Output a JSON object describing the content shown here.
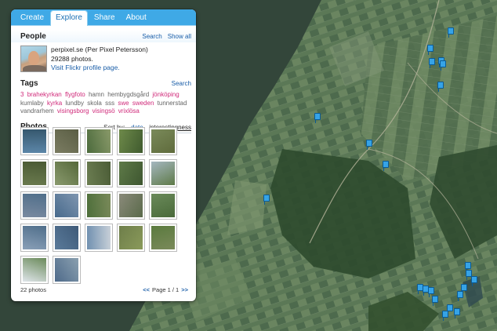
{
  "tabs": [
    {
      "label": "Create"
    },
    {
      "label": "Explore"
    },
    {
      "label": "Share"
    },
    {
      "label": "About"
    }
  ],
  "people": {
    "title": "People",
    "search_link": "Search",
    "show_all_link": "Show all",
    "user_name": "perpixel.se (Per Pixel Petersson)",
    "photo_count": "29288 photos.",
    "profile_link": "Visit Flickr profile page."
  },
  "tags": {
    "title": "Tags",
    "search_link": "Search",
    "items": [
      {
        "text": "3",
        "color": "#d02a7a"
      },
      {
        "text": "brahekyrkan",
        "color": "#d02a7a"
      },
      {
        "text": "flygfoto",
        "color": "#d02a7a"
      },
      {
        "text": "hamn",
        "color": "#666666"
      },
      {
        "text": "hembygdsgård",
        "color": "#666666"
      },
      {
        "text": "jönköping",
        "color": "#d02a7a"
      },
      {
        "text": "kumlaby",
        "color": "#666666"
      },
      {
        "text": "kyrka",
        "color": "#d02a7a"
      },
      {
        "text": "lundby",
        "color": "#666666"
      },
      {
        "text": "skola",
        "color": "#666666"
      },
      {
        "text": "sss",
        "color": "#666666"
      },
      {
        "text": "swe",
        "color": "#d02a7a"
      },
      {
        "text": "sweden",
        "color": "#d02a7a"
      },
      {
        "text": "tunnerstad",
        "color": "#666666"
      },
      {
        "text": "vandrarhem",
        "color": "#666666"
      },
      {
        "text": "visingsborg",
        "color": "#d02a7a"
      },
      {
        "text": "visingsö",
        "color": "#d02a7a"
      },
      {
        "text": "vrixlösa",
        "color": "#d02a7a"
      }
    ]
  },
  "photos": {
    "title": "Photos",
    "sort_by_label": "Sort by:",
    "sort_date": "date",
    "sort_interestingness": "interestingness",
    "count_text": "22 photos",
    "pager_prev": "<<",
    "pager_text": "Page 1 / 1",
    "pager_next": ">>",
    "thumb_colors": [
      [
        "#5c86a8",
        "#36586e"
      ],
      [
        "#7b7c62",
        "#5a5e44"
      ],
      [
        "#4b6a3c",
        "#8a9a6a"
      ],
      [
        "#6e8a4a",
        "#3f5a2e"
      ],
      [
        "#7a8a5a",
        "#5f6b3c"
      ],
      [
        "#6a7a4e",
        "#4a5a34"
      ],
      [
        "#8a9a6e",
        "#55683a"
      ],
      [
        "#6c7e52",
        "#4b5c36"
      ],
      [
        "#5e7a48",
        "#3e5630"
      ],
      [
        "#a5b7c0",
        "#5e7a48"
      ],
      [
        "#7a8aa0",
        "#4f6e8a"
      ],
      [
        "#486a8c",
        "#7f96b0"
      ],
      [
        "#4d6e3a",
        "#7a8a5a"
      ],
      [
        "#8a8a7a",
        "#5a6a4a"
      ],
      [
        "#6a8a5a",
        "#4a6a3a"
      ],
      [
        "#8aa0b8",
        "#4f6e8a"
      ],
      [
        "#5a7a9a",
        "#3e5a78"
      ],
      [
        "#7090b0",
        "#c8d0d8"
      ],
      [
        "#6e7e4a",
        "#8a9a5a"
      ],
      [
        "#5a7a3e",
        "#7a8a5a"
      ],
      [
        "#dfe5ea",
        "#6a8a5a"
      ],
      [
        "#4e6a8a",
        "#8aa0b0"
      ]
    ]
  }
}
